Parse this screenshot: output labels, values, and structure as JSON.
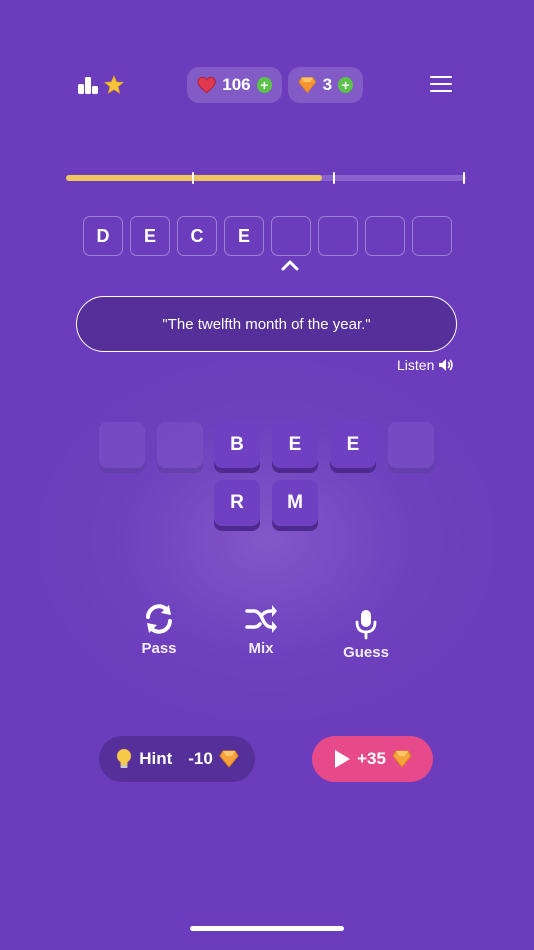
{
  "header": {
    "lives": "106",
    "gems": "3",
    "plus": "+"
  },
  "progress": {
    "value": 0.64
  },
  "answer": {
    "letters": [
      "D",
      "E",
      "C",
      "E",
      "",
      "",
      "",
      ""
    ]
  },
  "clue": {
    "text": "\"The twelfth month of the year.\"",
    "listen_label": "Listen"
  },
  "tiles": {
    "row1": [
      "",
      "",
      "B",
      "E",
      "E",
      ""
    ],
    "row2": [
      "R",
      "M"
    ]
  },
  "actions": {
    "pass_label": "Pass",
    "mix_label": "Mix",
    "guess_label": "Guess"
  },
  "buttons": {
    "hint_label": "Hint",
    "hint_cost": "-10",
    "video_reward": "+35"
  },
  "colors": {
    "background": "#6b3cbb",
    "accent_yellow": "#f0c75e",
    "video_pink": "#e64a8a",
    "plus_green": "#5cc24a"
  }
}
